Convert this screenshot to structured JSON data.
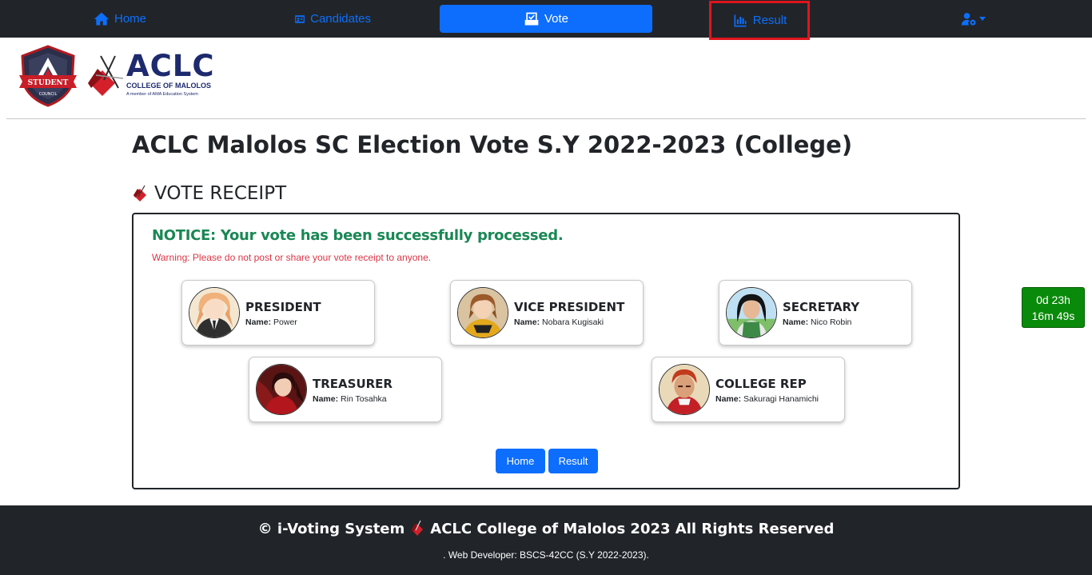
{
  "nav": {
    "home": "Home",
    "candidates": "Candidates",
    "vote": "Vote",
    "result": "Result",
    "user_icon": "user-gear-icon"
  },
  "logos": {
    "shield_text_1": "STUDENT",
    "shield_text_2": "COUNCIL",
    "aclc_main": "ACLC",
    "aclc_sub": "COLLEGE OF MALOLOS",
    "aclc_tag": "A member of AMA Education System"
  },
  "page": {
    "title": "ACLC Malolos SC Election Vote S.Y 2022-2023 (College)",
    "receipt_heading": "VOTE RECEIPT"
  },
  "receipt": {
    "notice": "NOTICE: Your vote has been successfully processed.",
    "warning": "Warning: Please do not post or share your vote receipt to anyone.",
    "name_label": "Name:",
    "candidates": [
      {
        "position": "PRESIDENT",
        "name": "Power"
      },
      {
        "position": "VICE PRESIDENT",
        "name": "Nobara Kugisaki"
      },
      {
        "position": "SECRETARY",
        "name": "Nico Robin"
      },
      {
        "position": "TREASURER",
        "name": "Rin Tosahka"
      },
      {
        "position": "COLLEGE REP",
        "name": "Sakuragi Hanamichi"
      }
    ],
    "buttons": {
      "home": "Home",
      "result": "Result"
    }
  },
  "timer": {
    "line1": "0d 23h",
    "line2": "16m 49s"
  },
  "footer": {
    "copyright_prefix": "© i-Voting System",
    "copyright_suffix": "ACLC College of Malolos 2023 All Rights Reserved",
    "developer": ". Web Developer: BSCS-42CC (S.Y 2022-2023)."
  },
  "colors": {
    "primary": "#0d6efd",
    "dark": "#212529",
    "success": "#198754",
    "danger": "#dc3545",
    "highlight": "#e0151c",
    "timer_bg": "#0a8a0a"
  }
}
